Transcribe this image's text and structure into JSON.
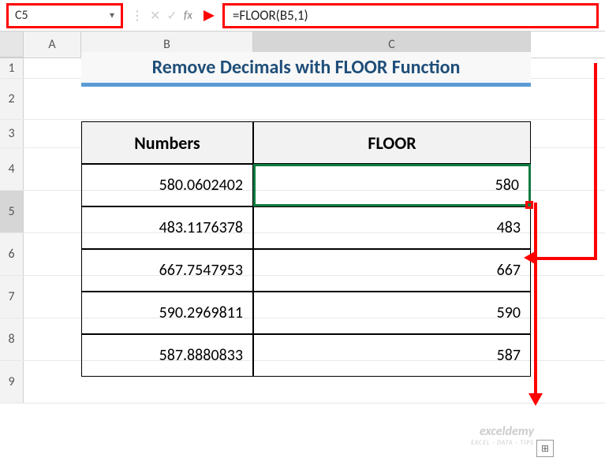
{
  "name_box": "C5",
  "formula": "=FLOOR(B5,1)",
  "fx_label": "fx",
  "columns": {
    "A": "A",
    "B": "B",
    "C": "C"
  },
  "row_numbers": [
    "1",
    "2",
    "3",
    "4",
    "5",
    "6",
    "7",
    "8",
    "9"
  ],
  "title": "Remove Decimals with FLOOR Function",
  "headers": {
    "numbers": "Numbers",
    "floor": "FLOOR"
  },
  "data": [
    {
      "num": "580.0602402",
      "floor": "580"
    },
    {
      "num": "483.1176378",
      "floor": "483"
    },
    {
      "num": "667.7547953",
      "floor": "667"
    },
    {
      "num": "590.2969811",
      "floor": "590"
    },
    {
      "num": "587.8880833",
      "floor": "587"
    }
  ],
  "watermark": {
    "line1": "exceldemy",
    "line2": "EXCEL · DATA · TIPS"
  },
  "chart_data": {
    "type": "table",
    "title": "Remove Decimals with FLOOR Function",
    "columns": [
      "Numbers",
      "FLOOR"
    ],
    "rows": [
      [
        580.0602402,
        580
      ],
      [
        483.1176378,
        483
      ],
      [
        667.7547953,
        667
      ],
      [
        590.2969811,
        590
      ],
      [
        587.8880833,
        587
      ]
    ],
    "formula": "=FLOOR(B5,1)",
    "active_cell": "C5"
  }
}
